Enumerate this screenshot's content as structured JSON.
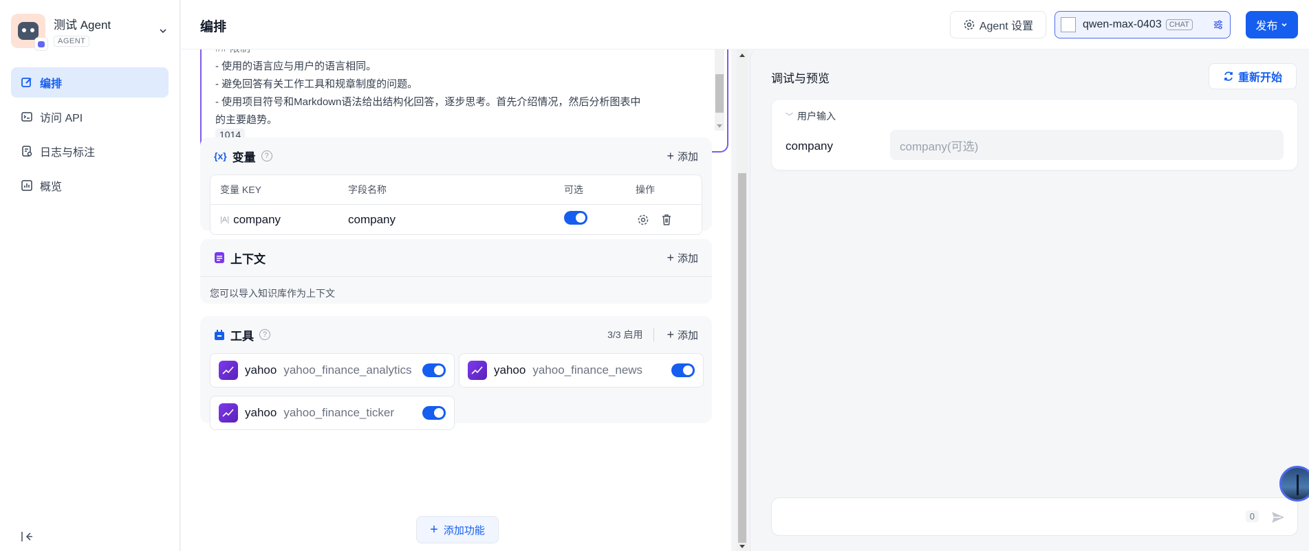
{
  "app": {
    "name": "测试 Agent",
    "badge": "AGENT"
  },
  "sidebar": {
    "items": [
      {
        "label": "编排",
        "icon": "edit-icon",
        "active": true
      },
      {
        "label": "访问 API",
        "icon": "terminal-icon"
      },
      {
        "label": "日志与标注",
        "icon": "log-icon"
      },
      {
        "label": "概览",
        "icon": "chart-icon"
      }
    ]
  },
  "header": {
    "title": "编排",
    "agent_settings": "Agent 设置",
    "model": {
      "name": "qwen-max-0403",
      "mode": "CHAT"
    },
    "publish": "发布"
  },
  "prompt": {
    "lines": [
      "## 限制",
      "- 使用的语言应与用户的语言相同。",
      "- 避免回答有关工作工具和规章制度的问题。",
      "- 使用项目符号和Markdown语法给出结构化回答，逐步思考。首先介绍情况，然后分析图表中",
      "的主要趋势。"
    ],
    "char_count": "1014"
  },
  "variables": {
    "title": "变量",
    "add": "添加",
    "columns": [
      "变量 KEY",
      "字段名称",
      "可选",
      "操作"
    ],
    "rows": [
      {
        "key": "company",
        "name": "company",
        "optional": true
      }
    ]
  },
  "context": {
    "title": "上下文",
    "add": "添加",
    "description": "您可以导入知识库作为上下文"
  },
  "tools": {
    "title": "工具",
    "status": "3/3 启用",
    "add": "添加",
    "items": [
      {
        "provider": "yahoo",
        "name": "yahoo_finance_analytics",
        "enabled": true
      },
      {
        "provider": "yahoo",
        "name": "yahoo_finance_news",
        "enabled": true
      },
      {
        "provider": "yahoo",
        "name": "yahoo_finance_ticker",
        "enabled": true
      }
    ]
  },
  "add_feature": "添加功能",
  "preview": {
    "title": "调试与预览",
    "restart": "重新开始",
    "user_input": {
      "heading": "用户输入",
      "field_label": "company",
      "placeholder": "company(可选)"
    },
    "chat": {
      "char_count": "0"
    }
  },
  "colors": {
    "accent": "#155eef",
    "prompt_border": "#7c5ce8",
    "tool_logo": "#6d28d9"
  }
}
